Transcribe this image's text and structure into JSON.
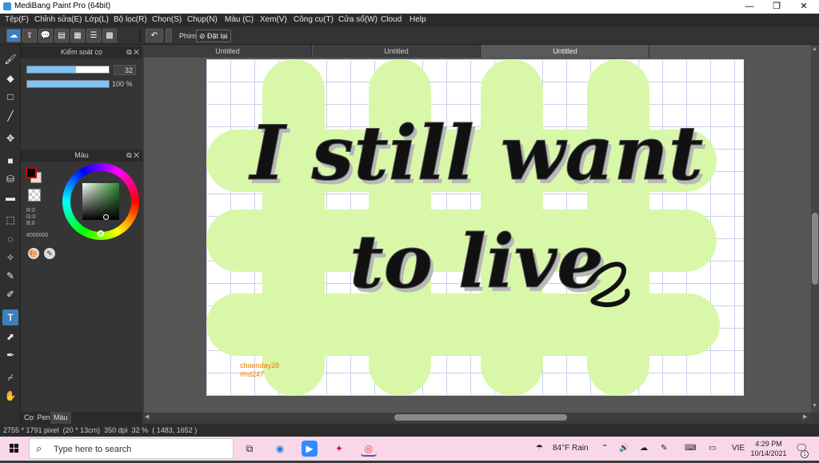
{
  "window": {
    "title": "MediBang Paint Pro (64bit)",
    "minimize_glyph": "—",
    "maximize_glyph": "❐",
    "close_glyph": "✕"
  },
  "menu": [
    "Tệp(F)",
    "Chỉnh sửa(E)",
    "Lớp(L)",
    "Bộ lọc(R)",
    "Chọn(S)",
    "Chụp(N)",
    "Màu (C)",
    "Xem(V)",
    "Công cụ(T)",
    "Cửa sổ(W)",
    "Cloud",
    "Help"
  ],
  "toolbar": {
    "phim_label": "Phím",
    "redo_label": "Đặt lại"
  },
  "brush_panel": {
    "title": "Kiểm soát cọ",
    "size_value": "32",
    "size_fraction": 0.6,
    "opacity_value": "100 %",
    "opacity_fraction": 1.0
  },
  "color_panel": {
    "title": "Màu",
    "r": "R:0",
    "g": "G:0",
    "b": "B:0",
    "hex": "#000000",
    "primary_color": "#000000",
    "secondary_color": "#f0d8c8"
  },
  "bottom_tabs": [
    "Cọ: Pen",
    "Màu"
  ],
  "doc_tabs": [
    "Untitled",
    "Untitled",
    "Untitled"
  ],
  "artwork": {
    "line1": "I still want",
    "line2": "to live",
    "signature_line1": "chaenday28",
    "signature_line2": "#hd247",
    "hash_color": "#d8f7a8",
    "signature_color": "#f07a00"
  },
  "status": {
    "size": "2755 * 1791 pixel",
    "physical": "(20 * 13cm)",
    "dpi": "350 dpi",
    "zoom": "32 %",
    "coords": "( 1483, 1652 )"
  },
  "taskbar": {
    "search_placeholder": "Type here to search",
    "weather": "84°F  Rain",
    "lang": "VIE",
    "time": "4:29 PM",
    "date": "10/14/2021",
    "notification_count": "1"
  }
}
